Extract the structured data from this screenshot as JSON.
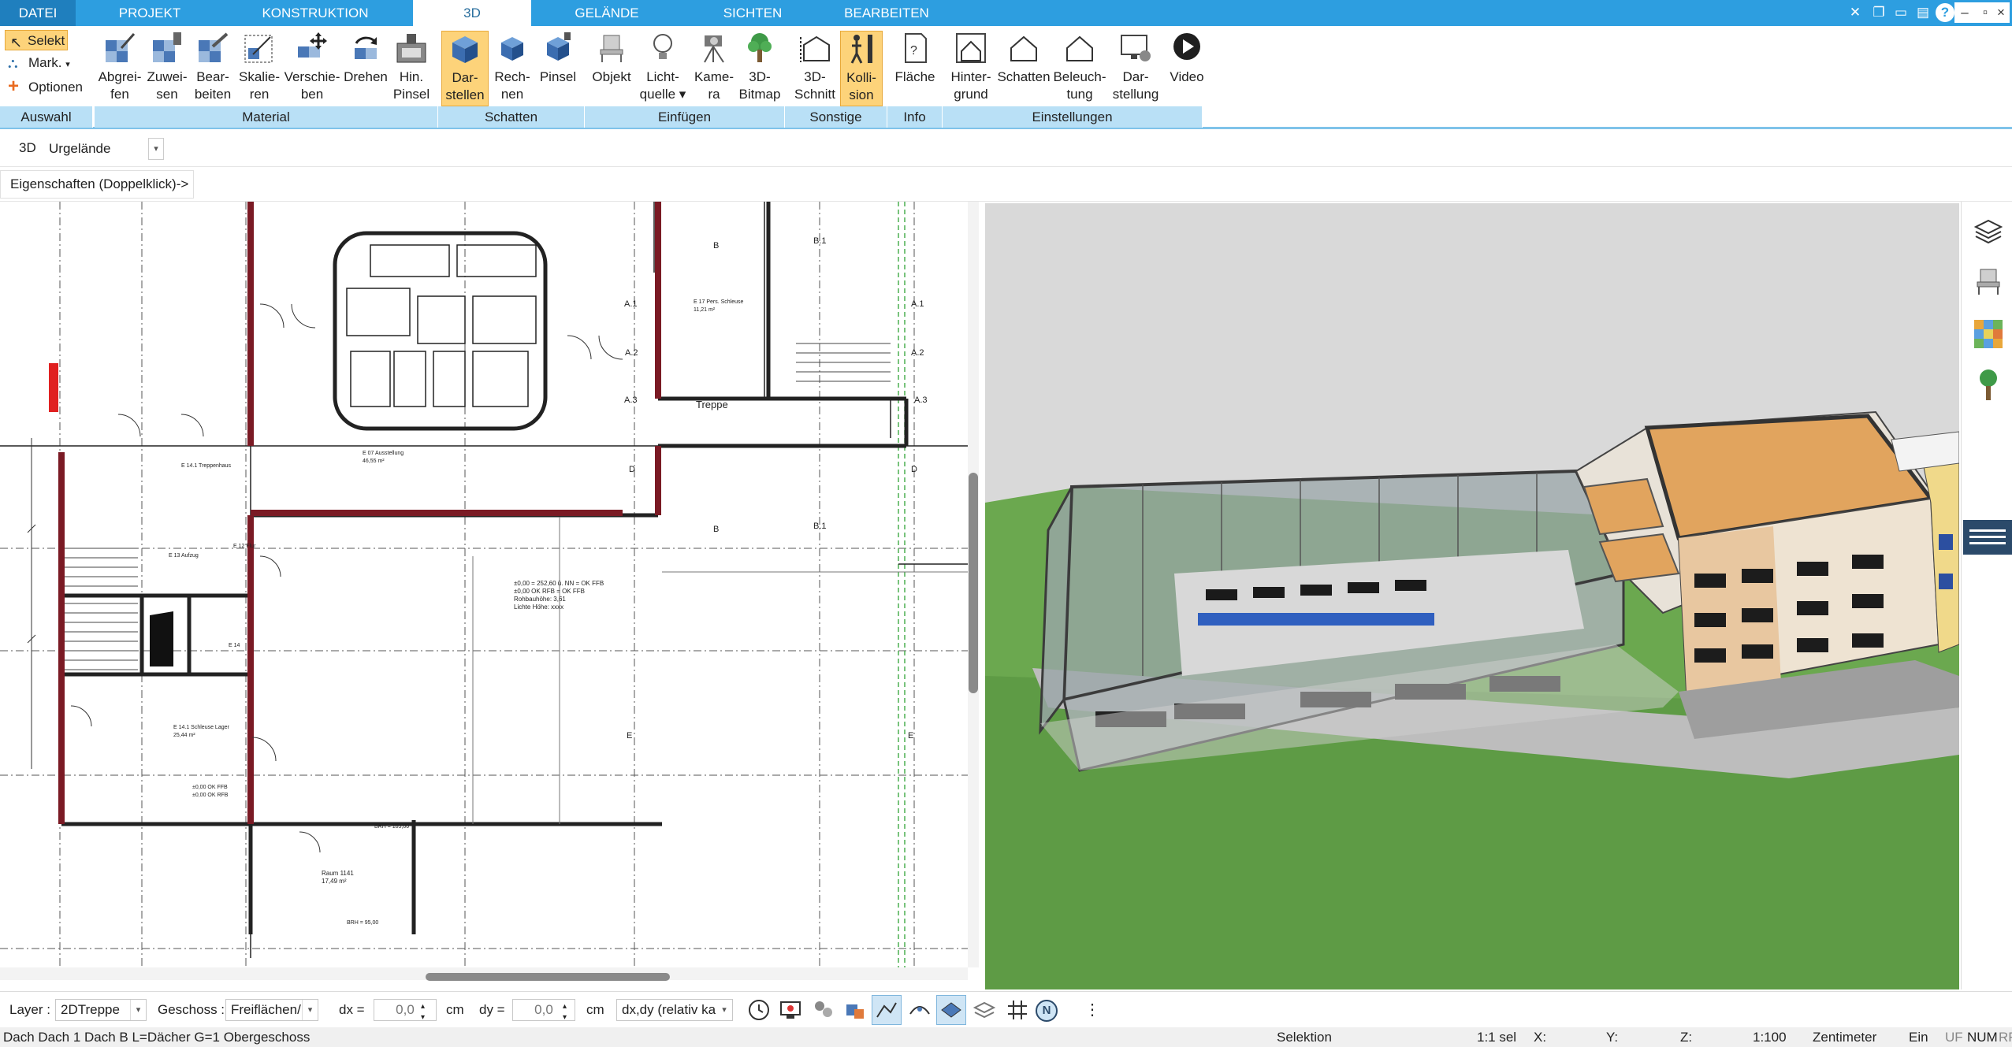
{
  "menu": {
    "tabs": [
      {
        "label": "DATEI"
      },
      {
        "label": "PROJEKT"
      },
      {
        "label": "KONSTRUKTION"
      },
      {
        "label": "3D"
      },
      {
        "label": "GELÄNDE"
      },
      {
        "label": "SICHTEN"
      },
      {
        "label": "BEARBEITEN"
      }
    ],
    "active_tab": "3D",
    "window_buttons": {
      "minimize": "–",
      "restore": "▫",
      "close": "×"
    },
    "help": "?"
  },
  "ribbon": {
    "auswahl": {
      "selekt": "Selekt",
      "mark": "Mark.",
      "optionen": "Optionen",
      "group": "Auswahl"
    },
    "material": {
      "buttons": [
        {
          "line1": "Abgrei-",
          "line2": "fen",
          "icon": "eyedropper-icon"
        },
        {
          "line1": "Zuwei-",
          "line2": "sen",
          "icon": "assign-icon"
        },
        {
          "line1": "Bear-",
          "line2": "beiten",
          "icon": "edit-material-icon"
        },
        {
          "line1": "Skalie-",
          "line2": "ren",
          "icon": "scale-icon"
        },
        {
          "line1": "Verschie-",
          "line2": "ben",
          "icon": "move-icon"
        },
        {
          "line1": "Drehen",
          "line2": "",
          "icon": "rotate-icon"
        },
        {
          "line1": "Hin.",
          "line2": "Pinsel",
          "icon": "background-brush-icon"
        }
      ],
      "group": "Material"
    },
    "schatten": {
      "buttons": [
        {
          "line1": "Dar-",
          "line2": "stellen",
          "icon": "cube-display-icon"
        },
        {
          "line1": "Rech-",
          "line2": "nen",
          "icon": "cube-compute-icon"
        },
        {
          "line1": "Pinsel",
          "line2": "",
          "icon": "cube-brush-icon"
        }
      ],
      "group": "Schatten"
    },
    "einfuegen": {
      "buttons": [
        {
          "line1": "Objekt",
          "line2": "",
          "icon": "chair-icon"
        },
        {
          "line1": "Licht-",
          "line2": "quelle ▾",
          "icon": "lightbulb-icon"
        },
        {
          "line1": "Kame-",
          "line2": "ra",
          "icon": "camera-icon"
        },
        {
          "line1": "3D-",
          "line2": "Bitmap",
          "icon": "tree-icon"
        }
      ],
      "group": "Einfügen"
    },
    "sonstige": {
      "buttons": [
        {
          "line1": "3D-",
          "line2": "Schnitt",
          "icon": "section-cut-icon"
        },
        {
          "line1": "Kolli-",
          "line2": "sion",
          "icon": "collision-icon"
        }
      ],
      "group": "Sonstige"
    },
    "info": {
      "buttons": [
        {
          "line1": "Fläche",
          "line2": "",
          "icon": "area-icon"
        }
      ],
      "group": "Info"
    },
    "einstellungen": {
      "buttons": [
        {
          "line1": "Hinter-",
          "line2": "grund",
          "icon": "background-icon"
        },
        {
          "line1": "Schatten",
          "line2": "",
          "icon": "house-shadow-icon"
        },
        {
          "line1": "Beleuch-",
          "line2": "tung",
          "icon": "house-light-icon"
        },
        {
          "line1": "Dar-",
          "line2": "stellung",
          "icon": "monitor-icon"
        },
        {
          "line1": "Video",
          "line2": "",
          "icon": "play-icon"
        }
      ],
      "group": "Einstellungen"
    }
  },
  "toolbar": {
    "mode": "3D",
    "terrain_value": "Urgelände",
    "properties_hint": "Eigenschaften (Doppelklick)->"
  },
  "plan": {
    "labels": {
      "treppe": "Treppe",
      "a1_left": "A.1",
      "a1_right": "A.1",
      "a2_left": "A.2",
      "a2_right": "A.2",
      "a3_left": "A.3",
      "a3_right": "A.3",
      "d_left": "D",
      "d_right": "D",
      "e_left": "E",
      "e_right": "E",
      "b_top": "B",
      "b1_top": "B.1",
      "b_mid": "B",
      "b1_mid": "B.1",
      "raum": "Raum 1141",
      "raum_area": "17,49 m²",
      "level1": "±0,00 = 252,60 ü. NN = OK FFB",
      "level2": "±0,00 OK RFB = OK FFB",
      "level3": "Rohbauhöhe: 3,61",
      "level4": "Lichte Höhe: xxxx",
      "e13": "E 13 Aufzug",
      "e14": "E 14",
      "e141": "E 14.1 Schleuse Lager",
      "e141_area": "25,44 m²",
      "treppenhaus": "E 14.1 Treppenhaus",
      "ausstellung": "E 07 Ausstellung",
      "ausstellung_area": "46,55 m²",
      "schleuse": "E 17 Pers. Schleuse",
      "schleuse_area": "11,21 m²",
      "flur": "E 12 Flur",
      "brh1": "BRH = 105,00",
      "brh2": "BRH = 95,00",
      "okffb": "±0,00 OK FFB",
      "okrfb": "±0,00 OK RFB"
    }
  },
  "bottom": {
    "layer_label": "Layer :",
    "layer_value": "2DTreppe",
    "geschoss_label": "Geschoss :",
    "geschoss_value": "Freiflächen/",
    "dx_label": "dx =",
    "dx_value": "0,0",
    "dx_unit": "cm",
    "dy_label": "dy =",
    "dy_value": "0,0",
    "dy_unit": "cm",
    "mode_value": "dx,dy (relativ ka",
    "north": "N",
    "more": "⋮"
  },
  "status": {
    "message": "Dach Dach 1 Dach B L=Dächer G=1 Obergeschoss",
    "selection": "Selektion",
    "sel_count": "1:1 sel",
    "x": "X:",
    "y": "Y:",
    "z": "Z:",
    "scale": "1:100",
    "unit": "Zentimeter",
    "ein": "Ein",
    "uf": "UF",
    "num": "NUM",
    "rf": "RF"
  },
  "colors": {
    "menubar": "#2d9ee0",
    "ribbon_group": "#b9e0f6",
    "active_button": "#fdd37a",
    "wall": "#7a1a24",
    "roof": "#e1a45e",
    "grass": "#6ba84f"
  }
}
